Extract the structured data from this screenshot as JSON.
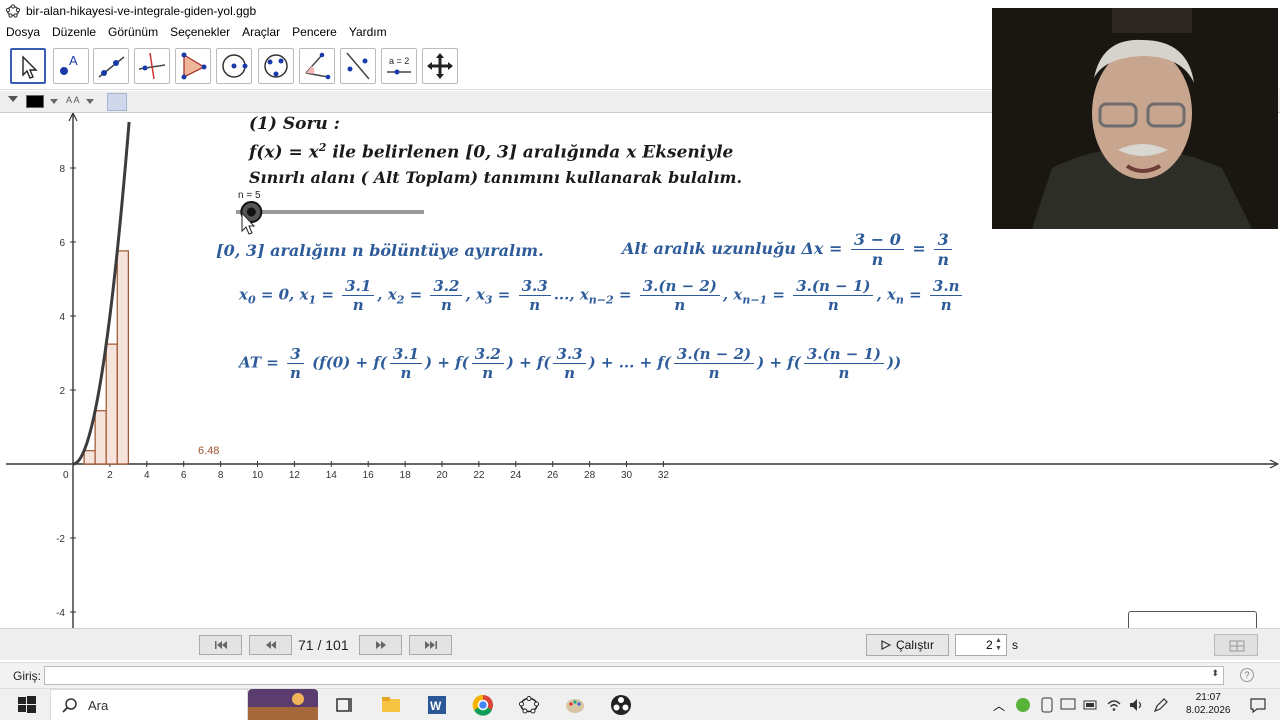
{
  "window": {
    "title": "bir-alan-hikayesi-ve-integrale-giden-yol.ggb"
  },
  "menu": [
    "Dosya",
    "Düzenle",
    "Görünüm",
    "Seçenekler",
    "Araçlar",
    "Pencere",
    "Yardım"
  ],
  "toolbar": {
    "tools": [
      {
        "name": "move-tool-icon"
      },
      {
        "name": "point-tool-icon"
      },
      {
        "name": "line-tool-icon"
      },
      {
        "name": "perpendicular-tool-icon"
      },
      {
        "name": "polygon-tool-icon"
      },
      {
        "name": "circle-tool-icon"
      },
      {
        "name": "conic-tool-icon"
      },
      {
        "name": "angle-tool-icon"
      },
      {
        "name": "reflect-tool-icon"
      },
      {
        "name": "slider-tool-icon"
      },
      {
        "name": "move-view-tool-icon"
      }
    ],
    "slider_label": "a = 2"
  },
  "stylebar": {
    "aa_label": "A A",
    "color": "#000000"
  },
  "graphics": {
    "text": {
      "soru": "(1) Soru :",
      "line2_a": "f(x) = x",
      "line2_sup": "2",
      "line2_b": " ile belirlenen [0, 3] aralığında x Ekseniyle",
      "line3": "Sınırlı alanı ( Alt Toplam) tanımını kullanarak bulalım.",
      "slider_label": "n = 5",
      "interval": "[0, 3] aralığını n bölüntüye ayıralım.",
      "subint": "Alt aralık uzunluğu Δx =",
      "frac1_num": "3 − 0",
      "frac_n": "n",
      "frac2_num": "3",
      "x_row": {
        "x0": "x",
        "x0_sub": "0",
        "x0_eq": " = 0,",
        "x1": "x",
        "x1_sub": "1",
        "x1_eq": " =",
        "x1_num": "3.1",
        "x2": "x",
        "x2_sub": "2",
        "x2_eq": " =",
        "x2_num": "3.2",
        "x3": "x",
        "x3_sub": "3",
        "x3_eq": " =",
        "x3_num": "3.3",
        "xn2": "x",
        "xn2_sub": "n−2",
        "xn2_eq": " =",
        "xn2_num": "3.(n − 2)",
        "xn1": "x",
        "xn1_sub": "n−1",
        "xn1_eq": " =",
        "xn1_num": "3.(n − 1)",
        "xn": "x",
        "xn_sub": "n",
        "xn_eq": " =",
        "xn_num": "3.n",
        "dots": "...,",
        "comma": ","
      },
      "at_row": {
        "lhs": "AT =",
        "pre": "(f(0) + f(",
        "p1": ") + f(",
        "p2": ") + f(",
        "p3": ") + ... + f(",
        "p4": ") + f(",
        "end": "))",
        "n1": "3.1",
        "n2": "3.2",
        "n3": "3.3",
        "n4": "3.(n − 2)",
        "n5": "3.(n − 1)",
        "lead": "3"
      },
      "area_value": "6.48"
    },
    "axes": {
      "x_ticks": [
        "2",
        "4",
        "6",
        "8",
        "10",
        "12",
        "14",
        "16",
        "18",
        "20",
        "22",
        "24",
        "26",
        "28",
        "30",
        "32"
      ],
      "y_ticks": [
        "8",
        "6",
        "4",
        "2",
        "-2",
        "-4"
      ],
      "origin": "0"
    },
    "slider_n": 5,
    "slider_range": [
      1,
      50
    ],
    "curve": "x^2",
    "interval": [
      0,
      3
    ]
  },
  "playback": {
    "counter": "71 / 101",
    "run_label": "Çalıştır",
    "speed_value": "2",
    "unit": "s"
  },
  "input_bar": {
    "label": "Giriş:",
    "help": "?"
  },
  "taskbar": {
    "search_placeholder": "Ara",
    "time": "21:07",
    "date": "8.02.2026"
  }
}
